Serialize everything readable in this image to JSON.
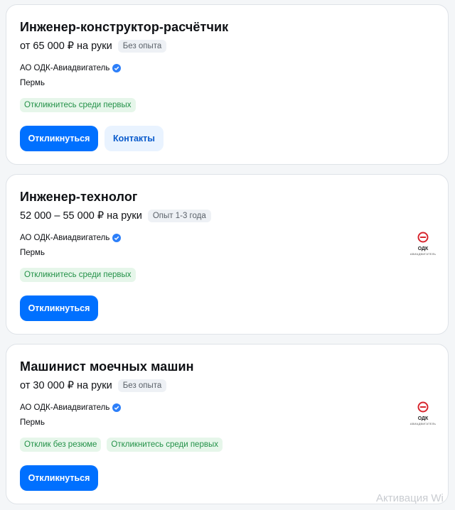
{
  "vacancies": [
    {
      "title": "Инженер-конструктор-расчётчик",
      "salary": "от 65 000 ₽ на руки",
      "experience": "Без опыта",
      "company": "АО ОДК-Авиадвигатель",
      "city": "Пермь",
      "tags": [
        "Откликнитесь среди первых"
      ],
      "apply_label": "Откликнуться",
      "contacts_label": "Контакты"
    },
    {
      "title": "Инженер-технолог",
      "salary": "52 000 – 55 000 ₽ на руки",
      "experience": "Опыт 1-3 года",
      "company": "АО ОДК-Авиадвигатель",
      "city": "Пермь",
      "tags": [
        "Откликнитесь среди первых"
      ],
      "apply_label": "Откликнуться",
      "logo_text": "ОДК",
      "logo_sub": "АВИАДВИГАТЕЛЬ"
    },
    {
      "title": "Машинист моечных машин",
      "salary": "от 30 000 ₽ на руки",
      "experience": "Без опыта",
      "company": "АО ОДК-Авиадвигатель",
      "city": "Пермь",
      "tags": [
        "Отклик без резюме",
        "Откликнитесь среди первых"
      ],
      "apply_label": "Откликнуться",
      "logo_text": "ОДК",
      "logo_sub": "АВИАДВИГАТЕЛЬ"
    }
  ],
  "watermark": "Активация Wi",
  "colors": {
    "primary": "#0070ff",
    "tag_bg": "#e6f6ea",
    "tag_text": "#239148",
    "verified": "#2d7ff9",
    "logo_red": "#d7262e"
  },
  "icons": {
    "verified": "verified-check-icon",
    "logo": "odk-logo-icon"
  }
}
